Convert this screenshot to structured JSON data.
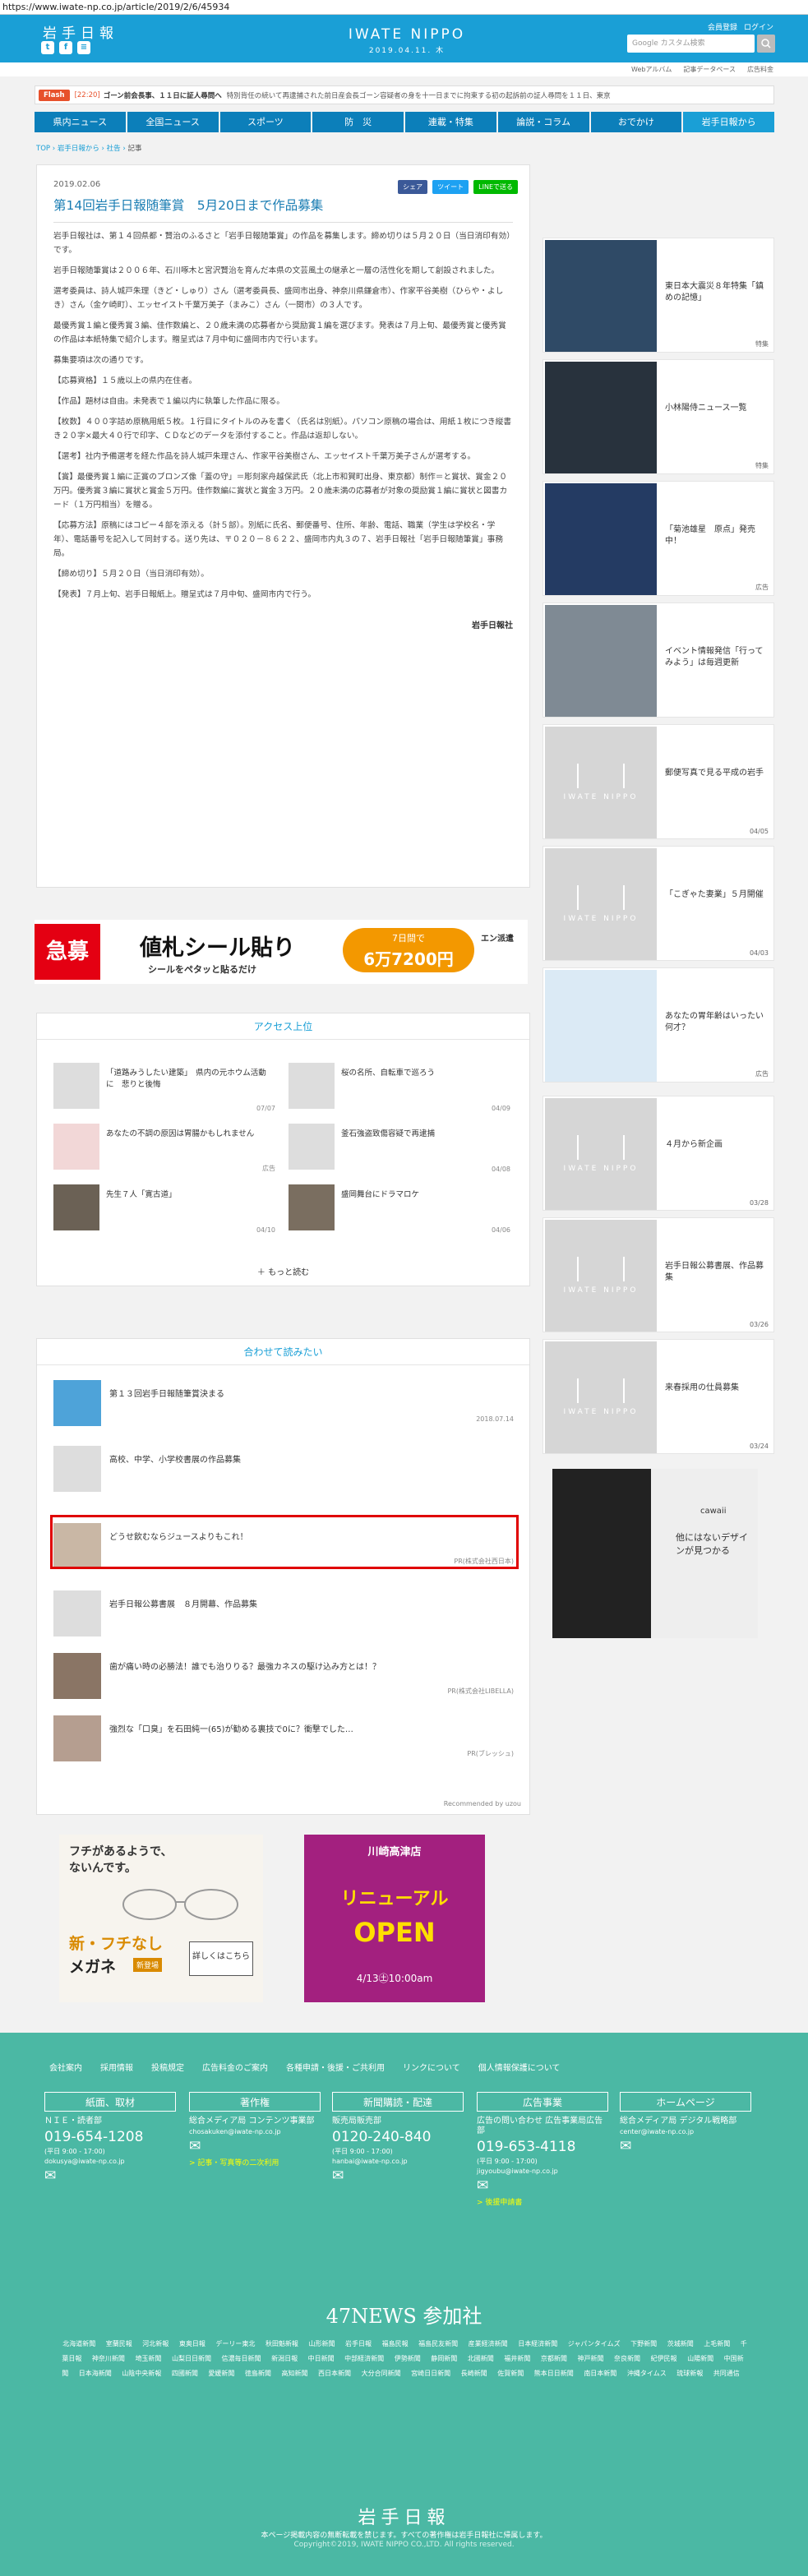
{
  "url": "https://www.iwate-np.co.jp/article/2019/2/6/45934",
  "header": {
    "logo": "岩手日報",
    "masthead": "IWATE NIPPO",
    "date": "2019.04.11. 木",
    "account": [
      "会員登録",
      "ログイン"
    ],
    "search_placeholder": "Google カスタム検索",
    "subnav": [
      "Webアルバム",
      "記事データベース",
      "広告料金"
    ]
  },
  "flash": {
    "label": "Flash",
    "time": "[22:20]",
    "headline": "ゴーン前会長事、１１日に証人尋問へ",
    "body": "特別背任の続いて再逮捕された前日産会長ゴーン容疑者の身を十一日までに拘束する初の起訴前の証人尋問を１１日、東京"
  },
  "nav": [
    "県内ニュース",
    "全国ニュース",
    "スポーツ",
    "防　災",
    "連載・特集",
    "論説・コラム",
    "おでかけ",
    "岩手日報から"
  ],
  "breadcrumb": [
    "TOP",
    "岩手日報から",
    "社告",
    "記事"
  ],
  "article": {
    "date": "2019.02.06",
    "title": "第14回岩手日報随筆賞　5月20日まで作品募集",
    "shares": [
      "シェア",
      "ツイート",
      "LINEで送る"
    ],
    "paragraphs": [
      "岩手日報社は、第１４回県都・賢治のふるさと「岩手日報随筆賞」の作品を募集します。締め切りは５月２０日（当日消印有効）です。",
      "岩手日報随筆賞は２００６年、石川啄木と宮沢賢治を育んだ本県の文芸風土の継承と一層の活性化を期して創設されました。",
      "選考委員は、詩人城戸朱理（きど・しゅり）さん（選考委員長、盛岡市出身、神奈川県鎌倉市）、作家平谷美樹（ひらや・よしき）さん（金ケ崎町）、エッセイスト千葉万美子（まみこ）さん（一関市）の３人です。",
      "最優秀賞１編と優秀賞３編、佳作数編と、２０歳未満の応募者から奨励賞１編を選びます。発表は７月上旬、最優秀賞と優秀賞の作品は本紙特集で紹介します。贈呈式は７月中旬に盛岡市内で行います。",
      "募集要項は次の通りです。",
      "【応募資格】１５歳以上の県内在住者。",
      "【作品】題材は自由。未発表で１編以内に執筆した作品に限る。",
      "【枚数】４００字詰め原稿用紙５枚。１行目にタイトルのみを書く（氏名は別紙）。パソコン原稿の場合は、用紙１枚につき縦書き２０字×最大４０行で印字、ＣＤなどのデータを添付すること。作品は返却しない。",
      "【選考】社内予備選考を経た作品を詩人城戸朱理さん、作家平谷美樹さん、エッセイスト千葉万美子さんが選考する。",
      "【賞】最優秀賞１編に正賞のブロンズ像「蓋の守」＝彫刻家舟越保武氏（北上市和賀町出身、東京都）制作＝と賞状、賞金２０万円。優秀賞３編に賞状と賞金５万円。佳作数編に賞状と賞金３万円。２０歳未満の応募者が対象の奨励賞１編に賞状と図書カード（１万円相当）を贈る。",
      "【応募方法】原稿にはコピー４部を添える（計５部）。別紙に氏名、郵便番号、住所、年齢、電話、職業（学生は学校名・学年）、電話番号を記入して同封する。送り先は、〒０２０－８６２２、盛岡市内丸３の７、岩手日報社「岩手日報随筆賞」事務局。",
      "【締め切り】５月２０日（当日消印有効）。",
      "【発表】７月上旬、岩手日報紙上。贈呈式は７月中旬、盛岡市内で行う。"
    ],
    "signature": "岩手日報社"
  },
  "ad_banner": {
    "tag": "急募",
    "main": "値札シール貼り",
    "sub": "シールをペタッと貼るだけ",
    "pill_a": "7日間で",
    "pill_b": "6万7200円",
    "brand": "エン派遣"
  },
  "ranking": {
    "heading": "アクセス上位",
    "items": [
      {
        "text": "「道路みうしたい建築」　県内の元ホウム活動に　悲りと後悔",
        "date": "07/07"
      },
      {
        "text": "桜の名所、自転車で巡ろう",
        "date": "04/09"
      },
      {
        "text": "あなたの不調の原因は胃腸かもしれません",
        "date": "広告"
      },
      {
        "text": "釜石強盗致傷容疑で再逮捕",
        "date": "04/08"
      },
      {
        "text": "先生７人「寛古道」",
        "date": "04/10"
      },
      {
        "text": "盛岡舞台にドラマロケ",
        "date": "04/06"
      }
    ],
    "more": "もっと読む"
  },
  "related": {
    "heading": "合わせて読みたい",
    "items": [
      {
        "text": "第１３回岩手日報随筆賞決まる",
        "src": "2018.07.14"
      },
      {
        "text": "高校、中学、小学校書展の作品募集",
        "src": ""
      },
      {
        "text": "どうせ飲むならジュースよりもこれ！",
        "src": "PR(株式会社西日本)"
      },
      {
        "text": "岩手日報公募書展　８月開幕、作品募集",
        "src": ""
      },
      {
        "text": "歯が痛い時の必勝法！誰でも治りりる？最強カネスの駆け込み方とは！？",
        "src": "PR(株式会社LIBELLA)"
      },
      {
        "text": "強烈な「口臭」を石田純一(65)が勧める裏技で0に？衝撃でした…",
        "src": "PR(ブレッシュ)"
      }
    ],
    "powered": "Recommended by uzou"
  },
  "bottom_ads": {
    "left": {
      "l1": "フチがあるようで、",
      "l2": "ないんです。",
      "l3": "新・フチなし",
      "l4": "メガネ",
      "l5": "新登場",
      "l6": "詳しくはこちら"
    },
    "right": {
      "l1": "川崎高津店",
      "l2": "リニューアル",
      "l3": "OPEN",
      "l4": "4/13㊏10:00am"
    }
  },
  "sidebar": [
    {
      "text": "東日本大震災８年特集「鎮めの記憶」",
      "tag": "特集",
      "img": "shinsai"
    },
    {
      "text": "小林陽侍ニュース一覧",
      "tag": "特集",
      "img": "bird"
    },
    {
      "text": "「菊池雄星　原点」発売中！",
      "tag": "広告",
      "img": "kikuchi"
    },
    {
      "text": "イベント情報発信「行ってみよう」は毎週更新",
      "tag": "",
      "img": "photo"
    },
    {
      "text": "郵便写真で見る平成の岩手",
      "tag": "04/05",
      "img": "placeholder"
    },
    {
      "text": "「こぎゃた妻業」５月開催",
      "tag": "04/03",
      "img": "placeholder"
    },
    {
      "text": "あなたの胃年齢はいったい何才？",
      "tag": "広告",
      "img": "ad"
    },
    {
      "text": "４月から新企画",
      "tag": "03/28",
      "img": "placeholder"
    },
    {
      "text": "岩手日報公募書展、作品募集",
      "tag": "03/26",
      "img": "placeholder"
    },
    {
      "text": "来春採用の仕員募集",
      "tag": "03/24",
      "img": "placeholder"
    }
  ],
  "sidebar_ad": {
    "brand": "cawaii",
    "text": "他にはないデザインが見つかる"
  },
  "footer": {
    "links": [
      "会社案内",
      "採用情報",
      "投稿規定",
      "広告料金のご案内",
      "各種申請・後援・ご共利用",
      "リンクについて",
      "個人情報保護について"
    ],
    "cols": [
      {
        "head": "紙面、取材",
        "l1": "ＮＩＥ・読者部",
        "tel": "019-654-1208",
        "hours": "(平日 9:00 - 17:00)",
        "mail": "dokusya@iwate-np.co.jp",
        "extra": ""
      },
      {
        "head": "著作権",
        "l1": "総合メディア局 コンテンツ事業部",
        "tel": "",
        "hours": "",
        "mail": "chosakuken@iwate-np.co.jp",
        "extra": "> 記事・写真等の二次利用"
      },
      {
        "head": "新聞購読・配達",
        "l1": "販売局販売部",
        "tel": "0120-240-840",
        "hours": "(平日 9:00 - 17:00)",
        "mail": "hanbai@iwate-np.co.jp",
        "extra": ""
      },
      {
        "head": "広告事業",
        "l1": "広告の問い合わせ 広告事業局広告部",
        "tel": "019-653-4118",
        "hours": "(平日 9:00 - 17:00)",
        "mail": "jigyoubu@iwate-np.co.jp",
        "extra": "> 後援申請書"
      },
      {
        "head": "ホームページ",
        "l1": "総合メディア局 デジタル戦略部",
        "tel": "",
        "hours": "",
        "mail": "center@iwate-np.co.jp",
        "extra": ""
      }
    ],
    "news47_title": "47NEWS 参加社",
    "news47": [
      "北海道新聞",
      "室蘭民報",
      "河北新報",
      "東奥日報",
      "デーリー東北",
      "秋田魁新報",
      "山形新聞",
      "岩手日報",
      "福島民報",
      "福島民友新聞",
      "産業経済新聞",
      "日本経済新聞",
      "ジャパンタイムズ",
      "下野新聞",
      "茨城新聞",
      "上毛新聞",
      "千葉日報",
      "神奈川新聞",
      "埼玉新聞",
      "山梨日日新聞",
      "信濃毎日新聞",
      "新潟日報",
      "中日新聞",
      "中部経済新聞",
      "伊勢新聞",
      "静岡新聞",
      "北國新聞",
      "福井新聞",
      "京都新聞",
      "神戸新聞",
      "奈良新聞",
      "紀伊民報",
      "山陽新聞",
      "中国新聞",
      "日本海新聞",
      "山陰中央新報",
      "四國新聞",
      "愛媛新聞",
      "徳島新聞",
      "高知新聞",
      "西日本新聞",
      "大分合同新聞",
      "宮崎日日新聞",
      "長崎新聞",
      "佐賀新聞",
      "熊本日日新聞",
      "南日本新聞",
      "沖縄タイムス",
      "琉球新報",
      "共同通信"
    ],
    "mark": "岩手日報",
    "note": "本ページ掲載内容の無断転載を禁じます。すべての著作権は岩手日報社に帰属します。",
    "copyright": "Copyright©2019, IWATE NIPPO CO.,LTD. All rights reserved."
  },
  "colors": {
    "brand": "#1a9fd6",
    "nav": "#0c7fba",
    "footer": "#4bb8a4",
    "highlight": "#e00000"
  }
}
